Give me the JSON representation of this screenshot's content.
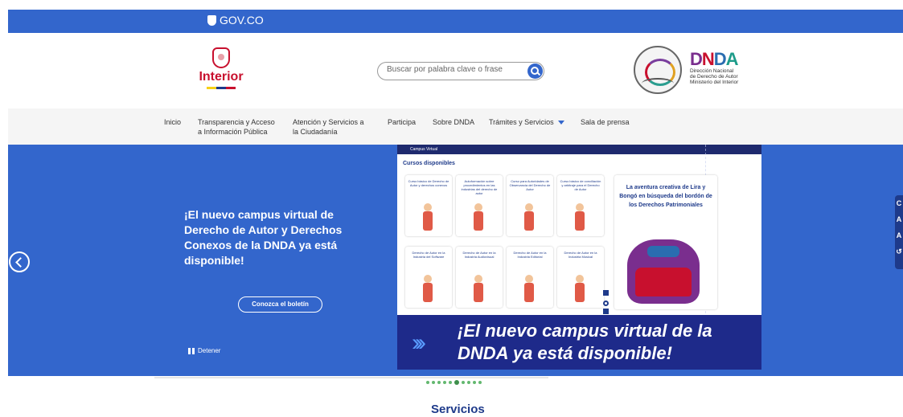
{
  "gov_bar": {
    "logo_text": "GOV.CO",
    "color": "#3366cc"
  },
  "header": {
    "ministry_name": "Interior",
    "search_placeholder": "Buscar por palabra clave o frase",
    "dnda_logo_letters": [
      "D",
      "N",
      "D",
      "A"
    ],
    "dnda_line1": "Dirección Nacional",
    "dnda_line2": "de Derecho de Autor",
    "dnda_line3": "Ministerio del Interior"
  },
  "nav": {
    "items": [
      {
        "label": "Inicio"
      },
      {
        "label": "Transparencia y Acceso",
        "label2": "a Información Pública"
      },
      {
        "label": "Atención y Servicios a",
        "label2": "la Ciudadanía"
      },
      {
        "label": "Participa"
      },
      {
        "label": "Sobre DNDA"
      },
      {
        "label": "Trámites y Servicios",
        "icon": "chevron-down-icon"
      },
      {
        "label": "Sala de prensa"
      }
    ]
  },
  "hero": {
    "title": "¡El nuevo campus virtual de Derecho de Autor y Derechos Conexos de la DNDA ya está disponible!",
    "button": "Conozca el boletín",
    "stop": "Detener",
    "banner": {
      "top_label": "Campus Virtual",
      "section_title": "Cursos disponibles",
      "cards": [
        "Curso básico de Derecho de Autor y derechos conexos",
        "Autoformación sobre procedimientos en las industrias del derecho de autor",
        "Curso para Autoridades de Observancia del Derecho de Autor",
        "Curso básico de conciliación y arbitraje para el Derecho de Autor",
        "Derecho de Autor en la Industria del Software",
        "Derecho de Autor en la Industria Audiovisual",
        "Derecho de Autor en la Industria Editorial",
        "Derecho de Autor en la Industria Musical"
      ],
      "feature_text": "La aventura creativa de Lira y Bongó en búsqueda del bordón de los Derechos Patrimoniales",
      "slogan_line1": "¡El nuevo campus virtual de la",
      "slogan_line2": "DNDA ya está disponible!"
    },
    "side_tabs": [
      "C",
      "A",
      "A",
      "↺"
    ]
  },
  "carousel": {
    "total": 10,
    "active_index": 5
  },
  "services": {
    "title": "Servicios"
  },
  "colors": {
    "primary": "#3366cc",
    "dark_blue": "#1e3a8a",
    "interior_red": "#c8102e",
    "dot_green": "#63b86f"
  }
}
